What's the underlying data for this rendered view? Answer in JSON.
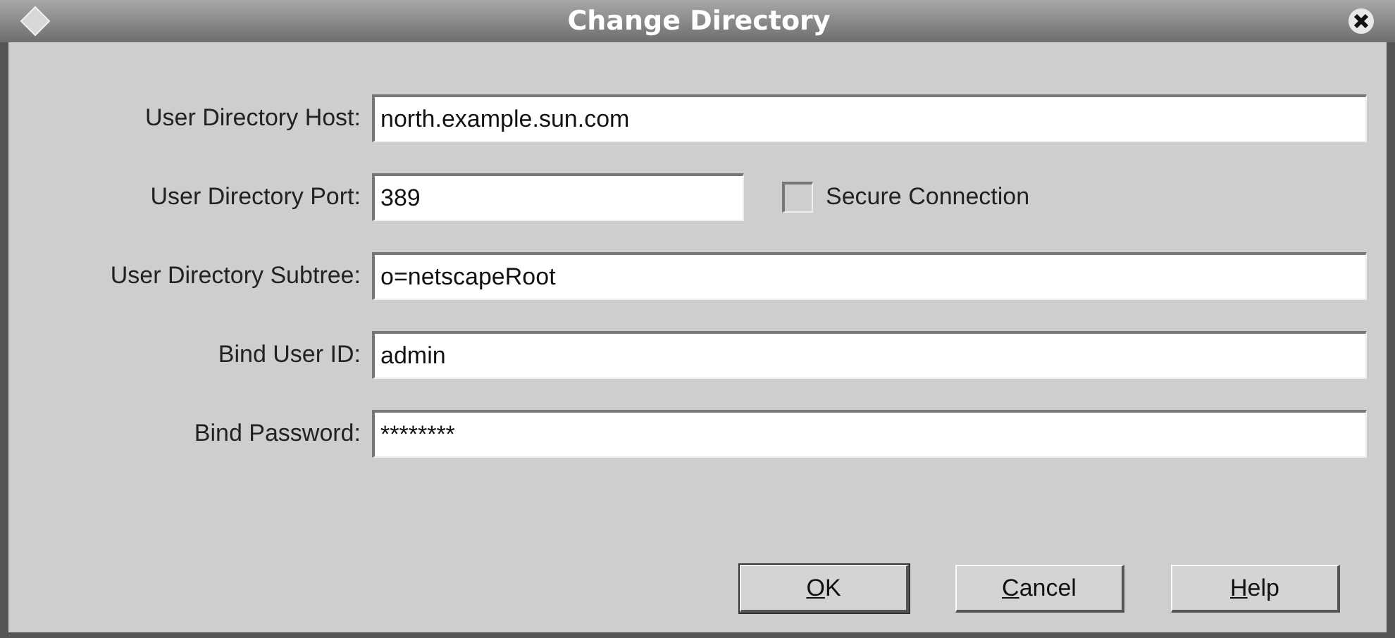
{
  "window": {
    "title": "Change Directory"
  },
  "fields": [
    {
      "label": "User Directory Host:",
      "value": "north.example.sun.com",
      "kind": "wide"
    },
    {
      "label": "User Directory Port:",
      "value": "389",
      "kind": "short",
      "checkbox": {
        "label": "Secure Connection",
        "checked": false
      }
    },
    {
      "label": "User Directory Subtree:",
      "value": "o=netscapeRoot",
      "kind": "wide"
    },
    {
      "label": "Bind User ID:",
      "value": "admin",
      "kind": "wide"
    },
    {
      "label": "Bind Password:",
      "value": "********",
      "kind": "wide"
    }
  ],
  "buttons": [
    {
      "label": "OK",
      "focused": true
    },
    {
      "label": "Cancel",
      "focused": false
    },
    {
      "label": "Help",
      "focused": false
    }
  ]
}
